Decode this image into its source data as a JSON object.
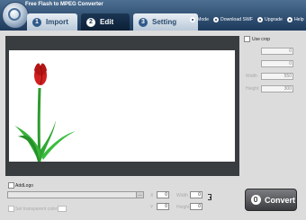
{
  "window": {
    "title": "Free Flash to MPEG Converter"
  },
  "tabs": [
    {
      "num": "1",
      "label": "Import"
    },
    {
      "num": "2",
      "label": "Edit"
    },
    {
      "num": "3",
      "label": "Setting"
    }
  ],
  "menu": [
    {
      "label": "Mode"
    },
    {
      "label": "Download SWF"
    },
    {
      "label": "Upgrade"
    },
    {
      "label": "Help"
    }
  ],
  "right_panel": {
    "use_crop_label": "Use crop",
    "fields": [
      {
        "label": "",
        "value": "0"
      },
      {
        "label": "",
        "value": "0"
      },
      {
        "label": "Width",
        "value": "550"
      },
      {
        "label": "Height",
        "value": "300"
      }
    ]
  },
  "bottom": {
    "add_logo_label": "AddLogo",
    "logo_path": "",
    "set_transparent_label": "Set transparent color",
    "pos_x_label": "X",
    "pos_x_value": "0",
    "pos_y_label": "Y",
    "pos_y_value": "0",
    "width_label": "Width",
    "width_value": "0",
    "height_label": "Height",
    "height_value": "0"
  },
  "convert": {
    "label": "Convert"
  },
  "colors": {
    "header_bg": "#1d3a5c",
    "preview_frame": "#3a3d40",
    "tab_active": "#1a3553"
  }
}
